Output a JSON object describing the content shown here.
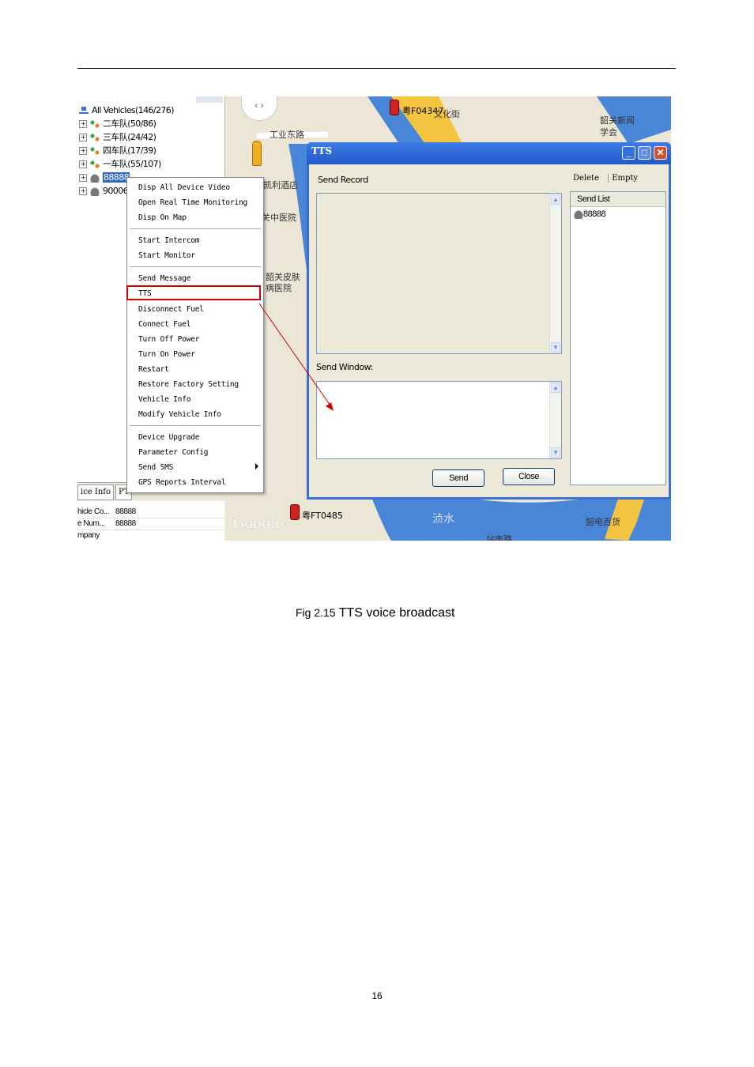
{
  "tree": {
    "root": "All Vehicles(146/276)",
    "groups": [
      "二车队(50/86)",
      "三车队(24/42)",
      "四车队(17/39)",
      "一车队(55/107)"
    ],
    "selected_vehicle": "88888",
    "vehicle2": "90006"
  },
  "info_panel": {
    "tabs": [
      "ice Info",
      "PT"
    ],
    "rows": [
      {
        "key": "hicle Co...",
        "value": "88888"
      },
      {
        "key": "e Num...",
        "value": "88888"
      },
      {
        "key": "mpany",
        "value": ""
      }
    ]
  },
  "map": {
    "labels": [
      "工业东路",
      "凯利酒店",
      "关中医院",
      "韶关皮肤",
      "病医院",
      "粤F04347",
      "文化街",
      "韶关新闻",
      "学会",
      "粤FT0485",
      "浈水",
      "韶电百货",
      "站南路"
    ],
    "logo": "Google"
  },
  "context_menu": {
    "items": [
      "Disp All Device Video",
      "Open Real Time Monitoring",
      "Disp On Map",
      "Start Intercom",
      "Start Monitor",
      "Send Message",
      "TTS",
      "Disconnect Fuel",
      "Connect Fuel",
      "Turn Off Power",
      "Turn On Power",
      "Restart",
      "Restore Factory Setting",
      "Vehicle Info",
      "Modify Vehicle Info",
      "Device Upgrade",
      "Parameter Config",
      "Send SMS",
      "GPS Reports Interval"
    ],
    "highlighted": "TTS"
  },
  "tts_window": {
    "title": "TTS",
    "send_record_label": "Send Record",
    "send_window_label": "Send Window:",
    "send_button": "Send",
    "close_button": "Close",
    "delete_label": "Delete",
    "empty_label": "Empty",
    "send_list_header": "Send List",
    "send_list_items": [
      "88888"
    ]
  },
  "caption": {
    "prefix": "Fig 2.15",
    "text": "TTS voice broadcast"
  },
  "page_number": "16",
  "colors": {
    "highlight_box": "#d40000",
    "titlebar": "#2358c8",
    "river": "#4a86d8",
    "road": "#f2c440"
  }
}
